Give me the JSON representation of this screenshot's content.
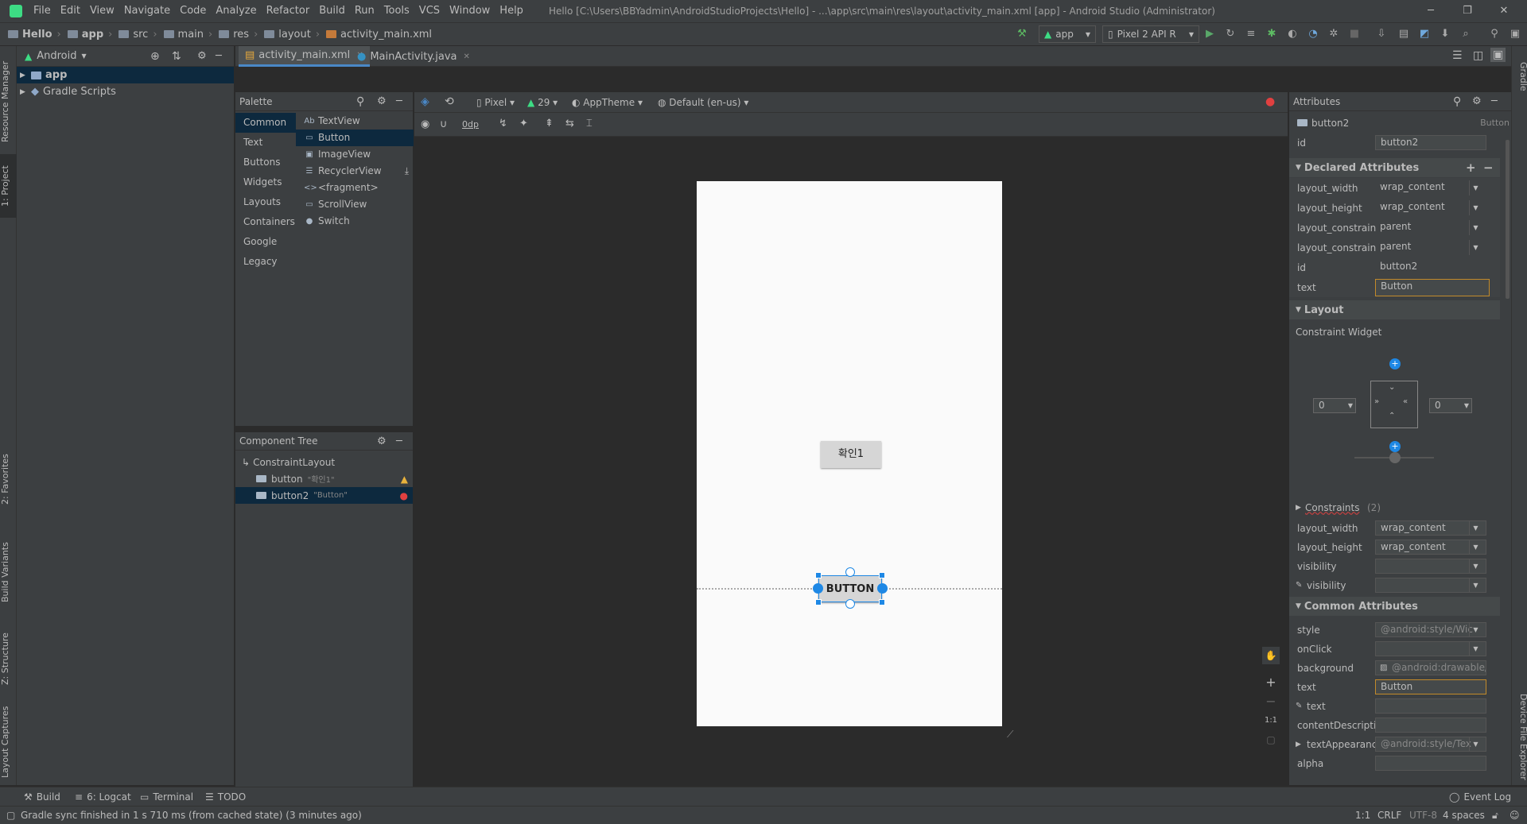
{
  "menubar": {
    "items": [
      "File",
      "Edit",
      "View",
      "Navigate",
      "Code",
      "Analyze",
      "Refactor",
      "Build",
      "Run",
      "Tools",
      "VCS",
      "Window",
      "Help"
    ],
    "title": "Hello [C:\\Users\\BBYadmin\\AndroidStudioProjects\\Hello] - ...\\app\\src\\main\\res\\layout\\activity_main.xml [app] - Android Studio (Administrator)"
  },
  "breadcrumbs": [
    "Hello",
    "app",
    "src",
    "main",
    "res",
    "layout",
    "activity_main.xml"
  ],
  "run": {
    "config": "app",
    "device": "Pixel 2 API R"
  },
  "left_tabs": {
    "resource_manager": "Resource Manager",
    "project": "1: Project",
    "favorites": "2: Favorites",
    "build_variants": "Build Variants",
    "structure": "Z: Structure",
    "layout_captures": "Layout Captures"
  },
  "right_tabs": {
    "gradle": "Gradle",
    "device_file_explorer": "Device File Explorer"
  },
  "project": {
    "view_mode": "Android",
    "items": [
      {
        "label": "app"
      },
      {
        "label": "Gradle Scripts"
      }
    ]
  },
  "editor_tabs": [
    {
      "label": "activity_main.xml"
    },
    {
      "label": "MainActivity.java"
    }
  ],
  "palette": {
    "title": "Palette",
    "categories": [
      "Common",
      "Text",
      "Buttons",
      "Widgets",
      "Layouts",
      "Containers",
      "Google",
      "Legacy"
    ],
    "items": [
      {
        "icon": "Ab",
        "label": "TextView"
      },
      {
        "icon": "▭",
        "label": "Button"
      },
      {
        "icon": "▣",
        "label": "ImageView"
      },
      {
        "icon": "☰",
        "label": "RecyclerView"
      },
      {
        "icon": "<>",
        "label": "<fragment>"
      },
      {
        "icon": "▭",
        "label": "ScrollView"
      },
      {
        "icon": "●",
        "label": "Switch"
      }
    ]
  },
  "component_tree": {
    "title": "Component Tree",
    "root": "ConstraintLayout",
    "children": [
      {
        "id": "button",
        "text": "\"확인1\"",
        "status": "warning"
      },
      {
        "id": "button2",
        "text": "\"Button\"",
        "status": "error"
      }
    ]
  },
  "design_toolbar": {
    "device": "Pixel",
    "api": "29",
    "theme": "AppTheme",
    "locale": "Default (en-us)",
    "margin": "0dp"
  },
  "device_preview": {
    "button1_label": "확인1",
    "button2_label": "BUTTON"
  },
  "zoom": {
    "ratio": "1:1"
  },
  "attributes": {
    "title": "Attributes",
    "component": "button2",
    "component_type": "Button",
    "id_label": "id",
    "id_value": "button2",
    "declared_title": "Declared Attributes",
    "declared": [
      {
        "name": "layout_width",
        "value": "wrap_content"
      },
      {
        "name": "layout_height",
        "value": "wrap_content"
      },
      {
        "name": "layout_constrain...",
        "value": "parent"
      },
      {
        "name": "layout_constrain...",
        "value": "parent"
      },
      {
        "name": "id",
        "value": "button2"
      },
      {
        "name": "text",
        "value": "Button"
      }
    ],
    "layout_title": "Layout",
    "constraint_widget": "Constraint Widget",
    "margin_left": "0",
    "margin_right": "0",
    "constraints": "Constraints",
    "constraints_count": "(2)",
    "layout_rows": [
      {
        "name": "layout_width",
        "value": "wrap_content"
      },
      {
        "name": "layout_height",
        "value": "wrap_content"
      },
      {
        "name": "visibility",
        "value": ""
      },
      {
        "name": "visibility",
        "value": ""
      }
    ],
    "common_title": "Common Attributes",
    "common": [
      {
        "name": "style",
        "value": "@android:style/Wic"
      },
      {
        "name": "onClick",
        "value": ""
      },
      {
        "name": "background",
        "value": "@android:drawable/b"
      },
      {
        "name": "text",
        "value": "Button"
      },
      {
        "name": "text",
        "value": ""
      },
      {
        "name": "contentDescription",
        "value": ""
      },
      {
        "name": "textAppearance",
        "value": "@android:style/Tex"
      },
      {
        "name": "alpha",
        "value": ""
      }
    ]
  },
  "toolwindows": [
    {
      "label": "Build"
    },
    {
      "label": "6: Logcat"
    },
    {
      "label": "Terminal"
    },
    {
      "label": "TODO"
    }
  ],
  "event_log": "Event Log",
  "status": {
    "message": "Gradle sync finished in 1 s 710 ms (from cached state) (3 minutes ago)",
    "position": "1:1",
    "line_sep": "CRLF",
    "encoding": "UTF-8",
    "indent": "4 spaces"
  }
}
